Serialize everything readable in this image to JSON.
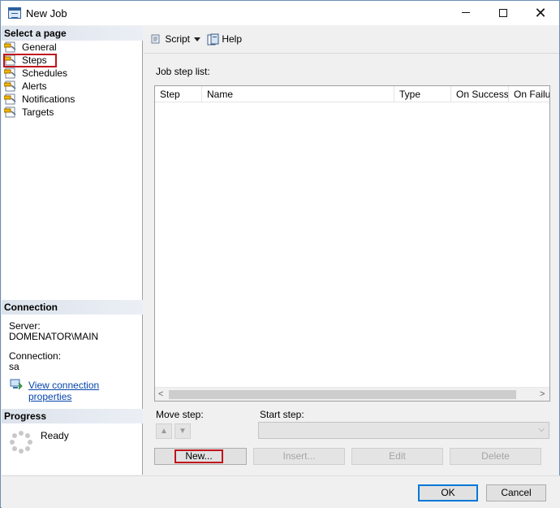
{
  "window": {
    "title": "New Job"
  },
  "left_pane": {
    "select_header": "Select a page",
    "pages": [
      {
        "label": "General",
        "icon": "page-wrench-icon"
      },
      {
        "label": "Steps",
        "icon": "page-wrench-icon"
      },
      {
        "label": "Schedules",
        "icon": "page-wrench-icon"
      },
      {
        "label": "Alerts",
        "icon": "page-wrench-icon"
      },
      {
        "label": "Notifications",
        "icon": "page-wrench-icon"
      },
      {
        "label": "Targets",
        "icon": "page-wrench-icon"
      }
    ],
    "selected_page": "Steps",
    "connection_header": "Connection",
    "server_label": "Server:",
    "server_value": "DOMENATOR\\MAIN",
    "connection_label": "Connection:",
    "connection_value": "sa",
    "view_link": "View connection properties",
    "progress_header": "Progress",
    "progress_status": "Ready"
  },
  "toolbar": {
    "script_label": "Script",
    "help_label": "Help"
  },
  "main": {
    "job_step_list_label": "Job step list:",
    "columns": [
      "Step",
      "Name",
      "Type",
      "On Success",
      "On Failure"
    ],
    "rows": [],
    "move_step_label": "Move step:",
    "start_step_label": "Start step:",
    "start_step_value": "",
    "buttons": {
      "new": "New...",
      "insert": "Insert...",
      "edit": "Edit",
      "delete": "Delete"
    }
  },
  "footer": {
    "ok": "OK",
    "cancel": "Cancel"
  },
  "colors": {
    "highlight": "#c0141c",
    "focus_border": "#0078d7",
    "link": "#0645ad"
  }
}
